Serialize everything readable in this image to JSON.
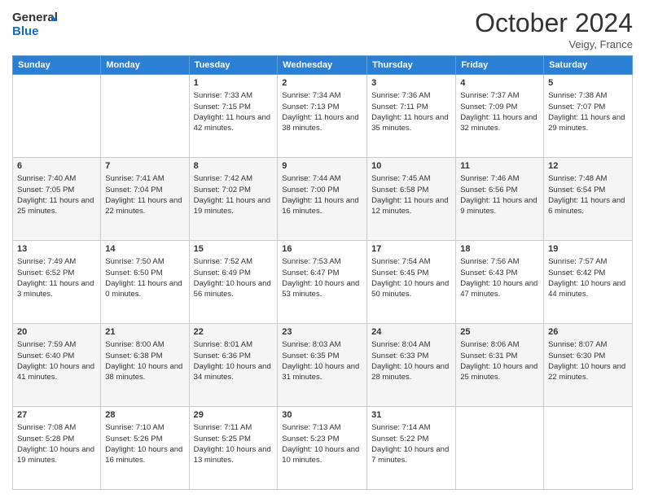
{
  "header": {
    "logo_line1": "General",
    "logo_line2": "Blue",
    "month": "October 2024",
    "location": "Veigy, France"
  },
  "days_of_week": [
    "Sunday",
    "Monday",
    "Tuesday",
    "Wednesday",
    "Thursday",
    "Friday",
    "Saturday"
  ],
  "weeks": [
    [
      {
        "day": "",
        "info": ""
      },
      {
        "day": "",
        "info": ""
      },
      {
        "day": "1",
        "info": "Sunrise: 7:33 AM\nSunset: 7:15 PM\nDaylight: 11 hours and 42 minutes."
      },
      {
        "day": "2",
        "info": "Sunrise: 7:34 AM\nSunset: 7:13 PM\nDaylight: 11 hours and 38 minutes."
      },
      {
        "day": "3",
        "info": "Sunrise: 7:36 AM\nSunset: 7:11 PM\nDaylight: 11 hours and 35 minutes."
      },
      {
        "day": "4",
        "info": "Sunrise: 7:37 AM\nSunset: 7:09 PM\nDaylight: 11 hours and 32 minutes."
      },
      {
        "day": "5",
        "info": "Sunrise: 7:38 AM\nSunset: 7:07 PM\nDaylight: 11 hours and 29 minutes."
      }
    ],
    [
      {
        "day": "6",
        "info": "Sunrise: 7:40 AM\nSunset: 7:05 PM\nDaylight: 11 hours and 25 minutes."
      },
      {
        "day": "7",
        "info": "Sunrise: 7:41 AM\nSunset: 7:04 PM\nDaylight: 11 hours and 22 minutes."
      },
      {
        "day": "8",
        "info": "Sunrise: 7:42 AM\nSunset: 7:02 PM\nDaylight: 11 hours and 19 minutes."
      },
      {
        "day": "9",
        "info": "Sunrise: 7:44 AM\nSunset: 7:00 PM\nDaylight: 11 hours and 16 minutes."
      },
      {
        "day": "10",
        "info": "Sunrise: 7:45 AM\nSunset: 6:58 PM\nDaylight: 11 hours and 12 minutes."
      },
      {
        "day": "11",
        "info": "Sunrise: 7:46 AM\nSunset: 6:56 PM\nDaylight: 11 hours and 9 minutes."
      },
      {
        "day": "12",
        "info": "Sunrise: 7:48 AM\nSunset: 6:54 PM\nDaylight: 11 hours and 6 minutes."
      }
    ],
    [
      {
        "day": "13",
        "info": "Sunrise: 7:49 AM\nSunset: 6:52 PM\nDaylight: 11 hours and 3 minutes."
      },
      {
        "day": "14",
        "info": "Sunrise: 7:50 AM\nSunset: 6:50 PM\nDaylight: 11 hours and 0 minutes."
      },
      {
        "day": "15",
        "info": "Sunrise: 7:52 AM\nSunset: 6:49 PM\nDaylight: 10 hours and 56 minutes."
      },
      {
        "day": "16",
        "info": "Sunrise: 7:53 AM\nSunset: 6:47 PM\nDaylight: 10 hours and 53 minutes."
      },
      {
        "day": "17",
        "info": "Sunrise: 7:54 AM\nSunset: 6:45 PM\nDaylight: 10 hours and 50 minutes."
      },
      {
        "day": "18",
        "info": "Sunrise: 7:56 AM\nSunset: 6:43 PM\nDaylight: 10 hours and 47 minutes."
      },
      {
        "day": "19",
        "info": "Sunrise: 7:57 AM\nSunset: 6:42 PM\nDaylight: 10 hours and 44 minutes."
      }
    ],
    [
      {
        "day": "20",
        "info": "Sunrise: 7:59 AM\nSunset: 6:40 PM\nDaylight: 10 hours and 41 minutes."
      },
      {
        "day": "21",
        "info": "Sunrise: 8:00 AM\nSunset: 6:38 PM\nDaylight: 10 hours and 38 minutes."
      },
      {
        "day": "22",
        "info": "Sunrise: 8:01 AM\nSunset: 6:36 PM\nDaylight: 10 hours and 34 minutes."
      },
      {
        "day": "23",
        "info": "Sunrise: 8:03 AM\nSunset: 6:35 PM\nDaylight: 10 hours and 31 minutes."
      },
      {
        "day": "24",
        "info": "Sunrise: 8:04 AM\nSunset: 6:33 PM\nDaylight: 10 hours and 28 minutes."
      },
      {
        "day": "25",
        "info": "Sunrise: 8:06 AM\nSunset: 6:31 PM\nDaylight: 10 hours and 25 minutes."
      },
      {
        "day": "26",
        "info": "Sunrise: 8:07 AM\nSunset: 6:30 PM\nDaylight: 10 hours and 22 minutes."
      }
    ],
    [
      {
        "day": "27",
        "info": "Sunrise: 7:08 AM\nSunset: 5:28 PM\nDaylight: 10 hours and 19 minutes."
      },
      {
        "day": "28",
        "info": "Sunrise: 7:10 AM\nSunset: 5:26 PM\nDaylight: 10 hours and 16 minutes."
      },
      {
        "day": "29",
        "info": "Sunrise: 7:11 AM\nSunset: 5:25 PM\nDaylight: 10 hours and 13 minutes."
      },
      {
        "day": "30",
        "info": "Sunrise: 7:13 AM\nSunset: 5:23 PM\nDaylight: 10 hours and 10 minutes."
      },
      {
        "day": "31",
        "info": "Sunrise: 7:14 AM\nSunset: 5:22 PM\nDaylight: 10 hours and 7 minutes."
      },
      {
        "day": "",
        "info": ""
      },
      {
        "day": "",
        "info": ""
      }
    ]
  ]
}
